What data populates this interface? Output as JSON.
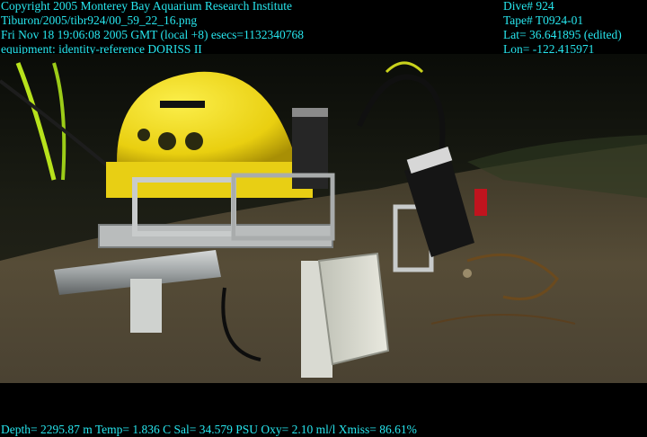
{
  "header_left": {
    "line1": "Copyright 2005 Monterey Bay Aquarium Research Institute",
    "line2": "Tiburon/2005/tibr924/00_59_22_16.png",
    "line3": "Fri Nov 18 19:06:08 2005 GMT (local +8)  esecs=1132340768",
    "line4": "equipment: identity-reference DORISS II"
  },
  "header_right": {
    "dive": "Dive# 924",
    "tape": "Tape# T0924-01",
    "lat": "Lat= 36.641895 (edited)",
    "lon": "Lon= -122.415971"
  },
  "footer": {
    "telemetry": "Depth= 2295.87 m  Temp= 1.836 C  Sal= 34.579 PSU  Oxy= 2.10 ml/l  Xmiss= 86.61%"
  },
  "colors": {
    "overlay_text": "#27e6ee",
    "instrument_yellow": "#f2dc16",
    "seafloor": "#4a4232"
  }
}
